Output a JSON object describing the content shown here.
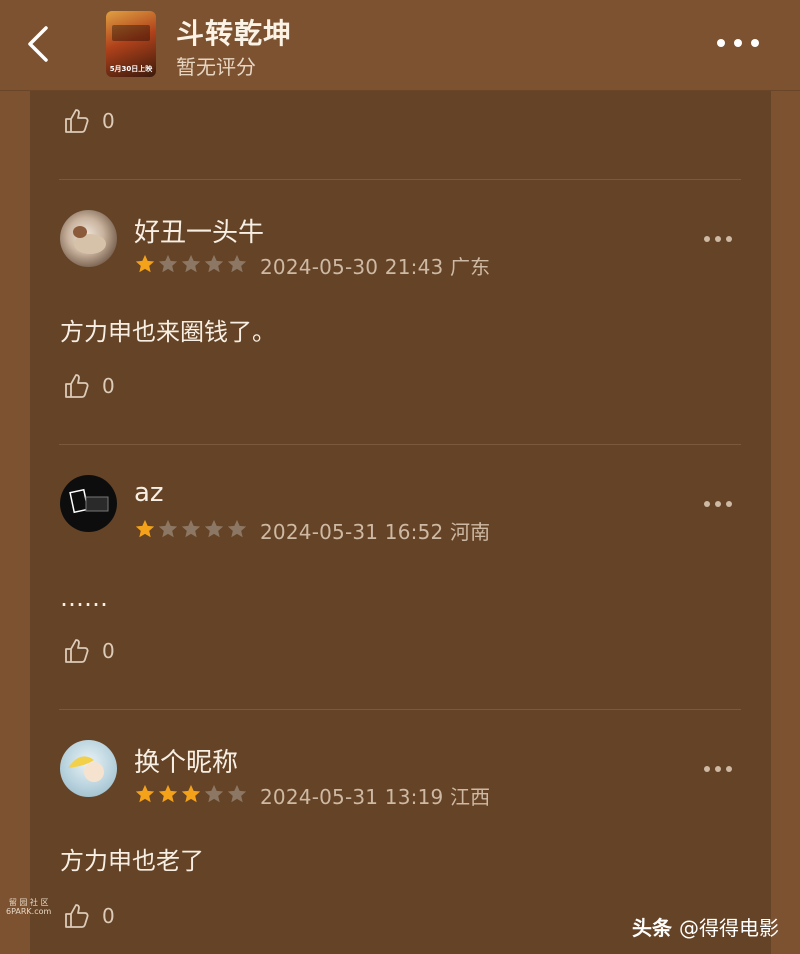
{
  "header": {
    "title": "斗转乾坤",
    "subtitle": "暂无评分",
    "poster_text": "5月30日上映"
  },
  "first_like": {
    "count": "0"
  },
  "comments": [
    {
      "username": "好丑一头牛",
      "rating": 1,
      "meta": "2024-05-30 21:43 广东",
      "content": "方力申也来圈钱了。",
      "likes": "0"
    },
    {
      "username": "az",
      "rating": 1,
      "meta": "2024-05-31 16:52 河南",
      "content": "……",
      "likes": "0"
    },
    {
      "username": "换个昵称",
      "rating": 3,
      "meta": "2024-05-31 13:19 江西",
      "content": "方力申也老了",
      "likes": "0"
    }
  ],
  "watermarks": {
    "left_line1": "留 园 社 区",
    "left_line2": "6PARK.com",
    "right_brand": "头条",
    "right_handle": "@得得电影"
  },
  "colors": {
    "star_filled": "#f5a21b",
    "star_empty": "#8c7764",
    "background": "#7c5230",
    "panel": "#654326"
  },
  "icons": [
    "back-icon",
    "more-icon",
    "thumbs-up-icon",
    "star-icon"
  ]
}
